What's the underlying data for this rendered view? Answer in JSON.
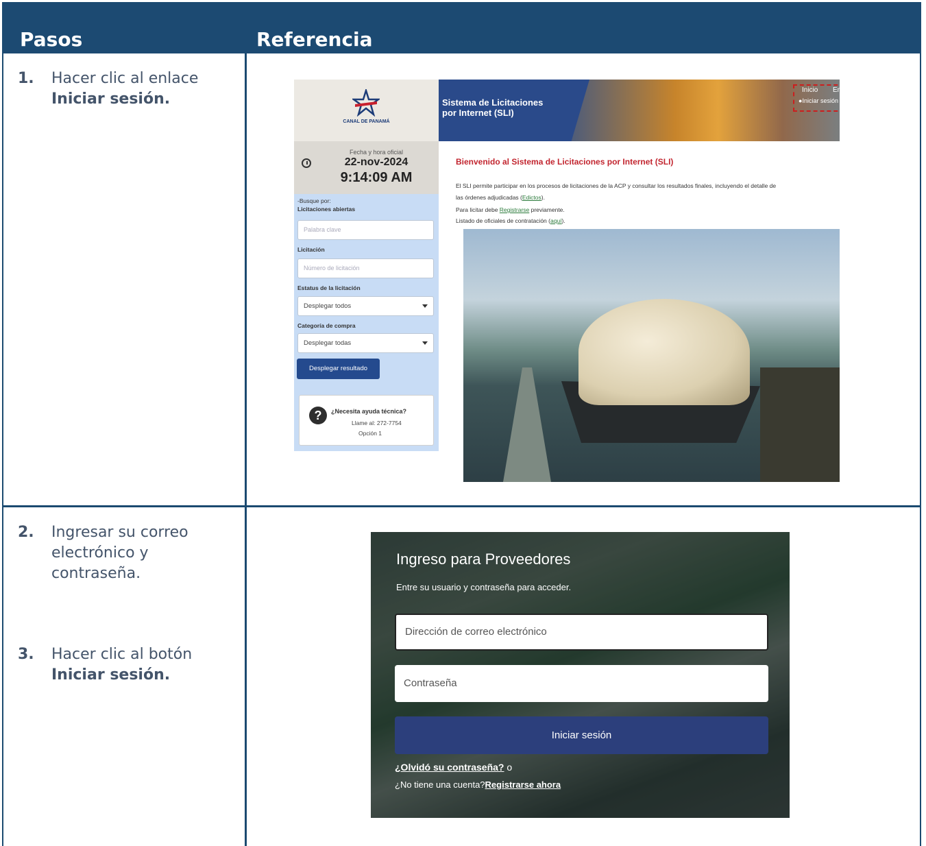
{
  "header": {
    "col1": "Pasos",
    "col2": "Referencia"
  },
  "steps": {
    "s1": {
      "num": "1.",
      "line1": "Hacer clic al enlace",
      "line2": "Iniciar sesión."
    },
    "s2": {
      "num": "2.",
      "line1": "Ingresar su correo",
      "line2": "electrónico y",
      "line3": "contraseña."
    },
    "s3": {
      "num": "3.",
      "line1": "Hacer clic al botón",
      "line2": "Iniciar sesión."
    }
  },
  "sli": {
    "logo_text": "CANAL DE PANAMÁ",
    "banner_title": "Sistema de Licitaciones\npor Internet (SLI)",
    "inicio": "Inicio",
    "english": "English",
    "iniciar_sesion": "Iniciar sesión",
    "fecha_label": "Fecha y hora oficial",
    "fecha": "22-nov-2024",
    "hora": "9:14:09 AM",
    "busque_por": "-Busque por:",
    "lic_abiertas": "Licitaciones abiertas",
    "palabra_clave_ph": "Palabra clave",
    "licitacion": "Licitación",
    "numero_ph": "Número de licitación",
    "estatus_label": "Estatus de la licitación",
    "estatus_value": "Desplegar todos",
    "categoria_label": "Categoría de compra",
    "categoria_value": "Desplegar todas",
    "desplegar_btn": "Desplegar resultado",
    "help_title": "¿Necesita ayuda técnica?",
    "help_phone": "Llame al: 272-7754",
    "help_option": "Opción 1",
    "welcome": "Bienvenido al Sistema de Licitaciones por Internet (SLI)",
    "intro1": "El SLI permite participar en los procesos de licitaciones de la ACP y consultar los resultados finales, incluyendo el detalle de",
    "intro2_pre": "las órdenes adjudicadas (",
    "intro2_link": "Edictos",
    "intro2_post": ").",
    "intro3_pre": "Para licitar debe ",
    "intro3_link": "Registrarse",
    "intro3_post": " previamente.",
    "intro4_pre": "Listado de oficiales de contratación (",
    "intro4_link": "aquí",
    "intro4_post": ")."
  },
  "login": {
    "title": "Ingreso para Proveedores",
    "subtitle": "Entre su usuario y contraseña para acceder.",
    "email_ph": "Dirección de correo electrónico",
    "password_ph": "Contraseña",
    "submit": "Iniciar sesión",
    "forgot": "¿Olvidó su contraseña?",
    "forgot_suffix": " o",
    "no_account": "¿No tiene una cuenta?",
    "register": "Registrarse ahora"
  }
}
